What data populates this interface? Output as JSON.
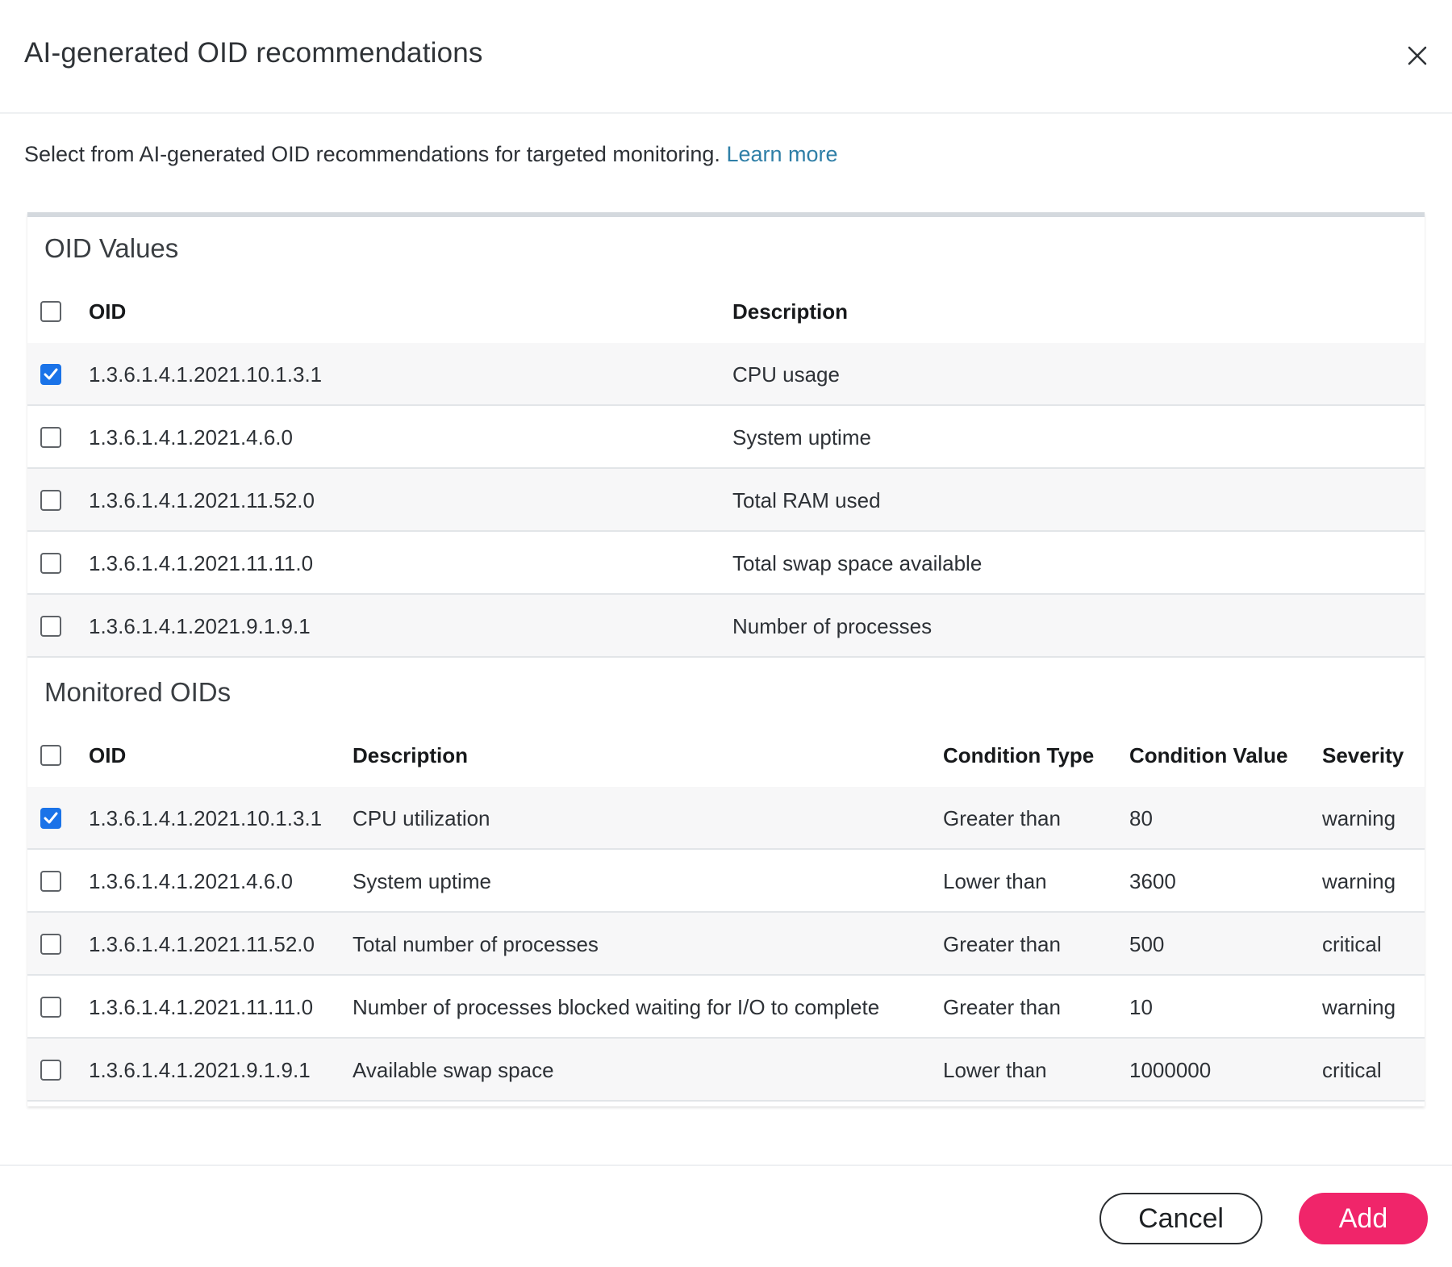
{
  "header": {
    "title": "AI-generated OID recommendations",
    "close_icon": "close-icon"
  },
  "intro": {
    "text": "Select from AI-generated OID recommendations for targeted monitoring.",
    "link_text": "Learn more"
  },
  "oid_values": {
    "title": "OID Values",
    "columns": {
      "oid": "OID",
      "description": "Description"
    },
    "select_all_checked": false,
    "rows": [
      {
        "oid": "1.3.6.1.4.1.2021.10.1.3.1",
        "description": "CPU usage",
        "checked": true
      },
      {
        "oid": "1.3.6.1.4.1.2021.4.6.0",
        "description": "System uptime",
        "checked": false
      },
      {
        "oid": "1.3.6.1.4.1.2021.11.52.0",
        "description": "Total RAM used",
        "checked": false
      },
      {
        "oid": "1.3.6.1.4.1.2021.11.11.0",
        "description": "Total swap space available",
        "checked": false
      },
      {
        "oid": "1.3.6.1.4.1.2021.9.1.9.1",
        "description": "Number of processes",
        "checked": false
      }
    ]
  },
  "monitored_oids": {
    "title": "Monitored OIDs",
    "columns": {
      "oid": "OID",
      "description": "Description",
      "condition_type": "Condition Type",
      "condition_value": "Condition Value",
      "severity": "Severity"
    },
    "select_all_checked": false,
    "rows": [
      {
        "oid": "1.3.6.1.4.1.2021.10.1.3.1",
        "description": "CPU utilization",
        "condition_type": "Greater than",
        "condition_value": "80",
        "severity": "warning",
        "checked": true
      },
      {
        "oid": "1.3.6.1.4.1.2021.4.6.0",
        "description": "System uptime",
        "condition_type": "Lower than",
        "condition_value": "3600",
        "severity": "warning",
        "checked": false
      },
      {
        "oid": "1.3.6.1.4.1.2021.11.52.0",
        "description": "Total number of processes",
        "condition_type": "Greater than",
        "condition_value": "500",
        "severity": "critical",
        "checked": false
      },
      {
        "oid": "1.3.6.1.4.1.2021.11.11.0",
        "description": "Number of processes blocked waiting for I/O to complete",
        "condition_type": "Greater than",
        "condition_value": "10",
        "severity": "warning",
        "checked": false
      },
      {
        "oid": "1.3.6.1.4.1.2021.9.1.9.1",
        "description": "Available swap space",
        "condition_type": "Lower than",
        "condition_value": "1000000",
        "severity": "critical",
        "checked": false
      }
    ]
  },
  "footer": {
    "cancel_label": "Cancel",
    "add_label": "Add"
  },
  "colors": {
    "link": "#2f7fa7",
    "checkbox_checked": "#1a73e8",
    "primary_button": "#f0256a"
  }
}
